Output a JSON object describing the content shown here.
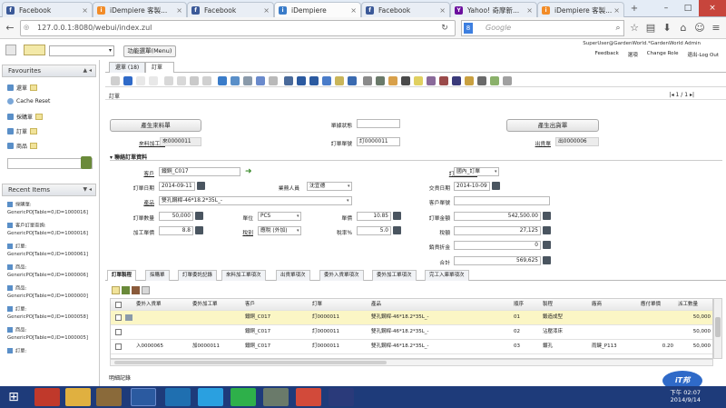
{
  "browser": {
    "tabs": [
      {
        "title": "Facebook",
        "color": "#3b5998",
        "glyph": "f"
      },
      {
        "title": "iDempiere 客製...",
        "color": "#f28c28",
        "glyph": "i"
      },
      {
        "title": "Facebook",
        "color": "#3b5998",
        "glyph": "f"
      },
      {
        "title": "iDempiere",
        "color": "#3a7cc9",
        "glyph": "i"
      },
      {
        "title": "Facebook",
        "color": "#3b5998",
        "glyph": "f"
      },
      {
        "title": "Yahoo! 奇摩新...",
        "color": "#6b0f9e",
        "glyph": "Y"
      },
      {
        "title": "iDempiere 客製...",
        "color": "#f28c28",
        "glyph": "i"
      }
    ],
    "url": "127.0.0.1:8080/webui/index.zul",
    "search_placeholder": "Google",
    "search_engine_label": "8"
  },
  "app": {
    "menu_button": "功能選單(Menu)",
    "user_info": "SuperUser@GardenWorld.*GardenWorld Admin",
    "links": [
      "Feedback",
      "選項",
      "Change Role",
      "退出-Log Out"
    ]
  },
  "favourites": {
    "title": "Favourites",
    "items": [
      "還單",
      "Cache Reset",
      "採購單",
      "訂單",
      "商品"
    ]
  },
  "recent": {
    "title": "Recent Items",
    "items": [
      "採購單:",
      "GenericPO[Table=0,ID=1000016]",
      "客戶訂單查詢:",
      "GenericPO[Table=0,ID=1000016]",
      "訂單:",
      "GenericPO[Table=0,ID=1000061]",
      "商品:",
      "GenericPO[Table=0,ID=1000006]",
      "商品:",
      "GenericPO[Table=0,ID=1000000]",
      "訂單:",
      "GenericPO[Table=0,ID=1000058]",
      "商品:",
      "GenericPO[Table=0,ID=1000005]",
      "訂單:"
    ]
  },
  "window_tabs": [
    {
      "label": "還單 (18)"
    },
    {
      "label": "訂單"
    }
  ],
  "record_nav": "1 / 1",
  "form": {
    "breadcrumb": "訂單",
    "btn_purchase": "產生來料單",
    "btn_ship": "產生出貨單",
    "doc_status_label": "單據狀態",
    "doc_status_value": "",
    "material_order_label": "來料加工單",
    "material_order_value": "來0000011",
    "order_no_label": "訂單單號",
    "order_no_value": "訂0000011",
    "ship_no_label": "出貨單",
    "ship_no_value": "出0000006",
    "section_title": "聯絡訂單資料",
    "customer_label": "客戶",
    "customer_value": "鐵銅_C017",
    "order_type_label": "訂單類別 ID",
    "order_type_value": "國內_訂單",
    "order_date_label": "訂單日期",
    "order_date_value": "2014-09-11",
    "sales_label": "業務人員",
    "sales_value": "沈宜德",
    "delivery_label": "交貨日期",
    "delivery_value": "2014-10-09",
    "product_label": "產品",
    "product_value": "雙孔鋼桿-46*18.2*35L_-",
    "cust_po_label": "客戶單號",
    "cust_po_value": "",
    "qty_label": "訂單數量",
    "qty_value": "50,000",
    "uom_label": "單位",
    "uom_value": "PCS",
    "unit_price_label": "單價",
    "unit_price_value": "10.85",
    "amount_label": "訂單金額",
    "amount_value": "542,500.00",
    "proc_price_label": "加工單價",
    "proc_price_value": "8.8",
    "tax_label": "稅別",
    "tax_value": "應稅 (外加)",
    "tax_rate_label": "稅率%",
    "tax_rate_value": "5.0",
    "tax_amt_label": "稅額",
    "tax_amt_value": "27,125",
    "discount_label": "銷貨折金",
    "discount_value": "0",
    "total_label": "合計",
    "total_value": "569,625"
  },
  "detail_tabs": [
    "訂單製程",
    "採購單",
    "訂單委託記錄",
    "來料加工單項次",
    "出貨單項次",
    "委外入貨單項次",
    "委外加工單項次",
    "完工入庫單項次"
  ],
  "grid": {
    "headers": [
      "",
      "委外入貨單",
      "委外加工單",
      "客戶",
      "訂單",
      "產品",
      "順序",
      "製程",
      "廠商",
      "應付單價",
      "派工數量"
    ],
    "rows": [
      {
        "in": "",
        "proc": "",
        "cust": "鐵銅_C017",
        "order": "訂0000011",
        "product": "雙孔鋼桿-46*18.2*35L_-",
        "seq": "01",
        "process": "鍛造成型",
        "vendor": "",
        "price": "",
        "qty": "50,000"
      },
      {
        "in": "",
        "proc": "",
        "cust": "鐵銅_C017",
        "order": "訂0000011",
        "product": "雙孔鋼桿-46*18.2*35L_-",
        "seq": "02",
        "process": "沾壓漆床",
        "vendor": "",
        "price": "",
        "qty": "50,000"
      },
      {
        "in": "入0000065",
        "proc": "加0000011",
        "cust": "鐵銅_C017",
        "order": "訂0000011",
        "product": "雙孔鋼桿-46*18.2*35L_-",
        "seq": "03",
        "process": "鍍孔",
        "vendor": "雨鍵_P113",
        "price": "0.20",
        "qty": "50,000"
      }
    ]
  },
  "footer_label": "明細記錄",
  "clock": {
    "time": "下午 02:07",
    "date": "2014/9/14"
  }
}
